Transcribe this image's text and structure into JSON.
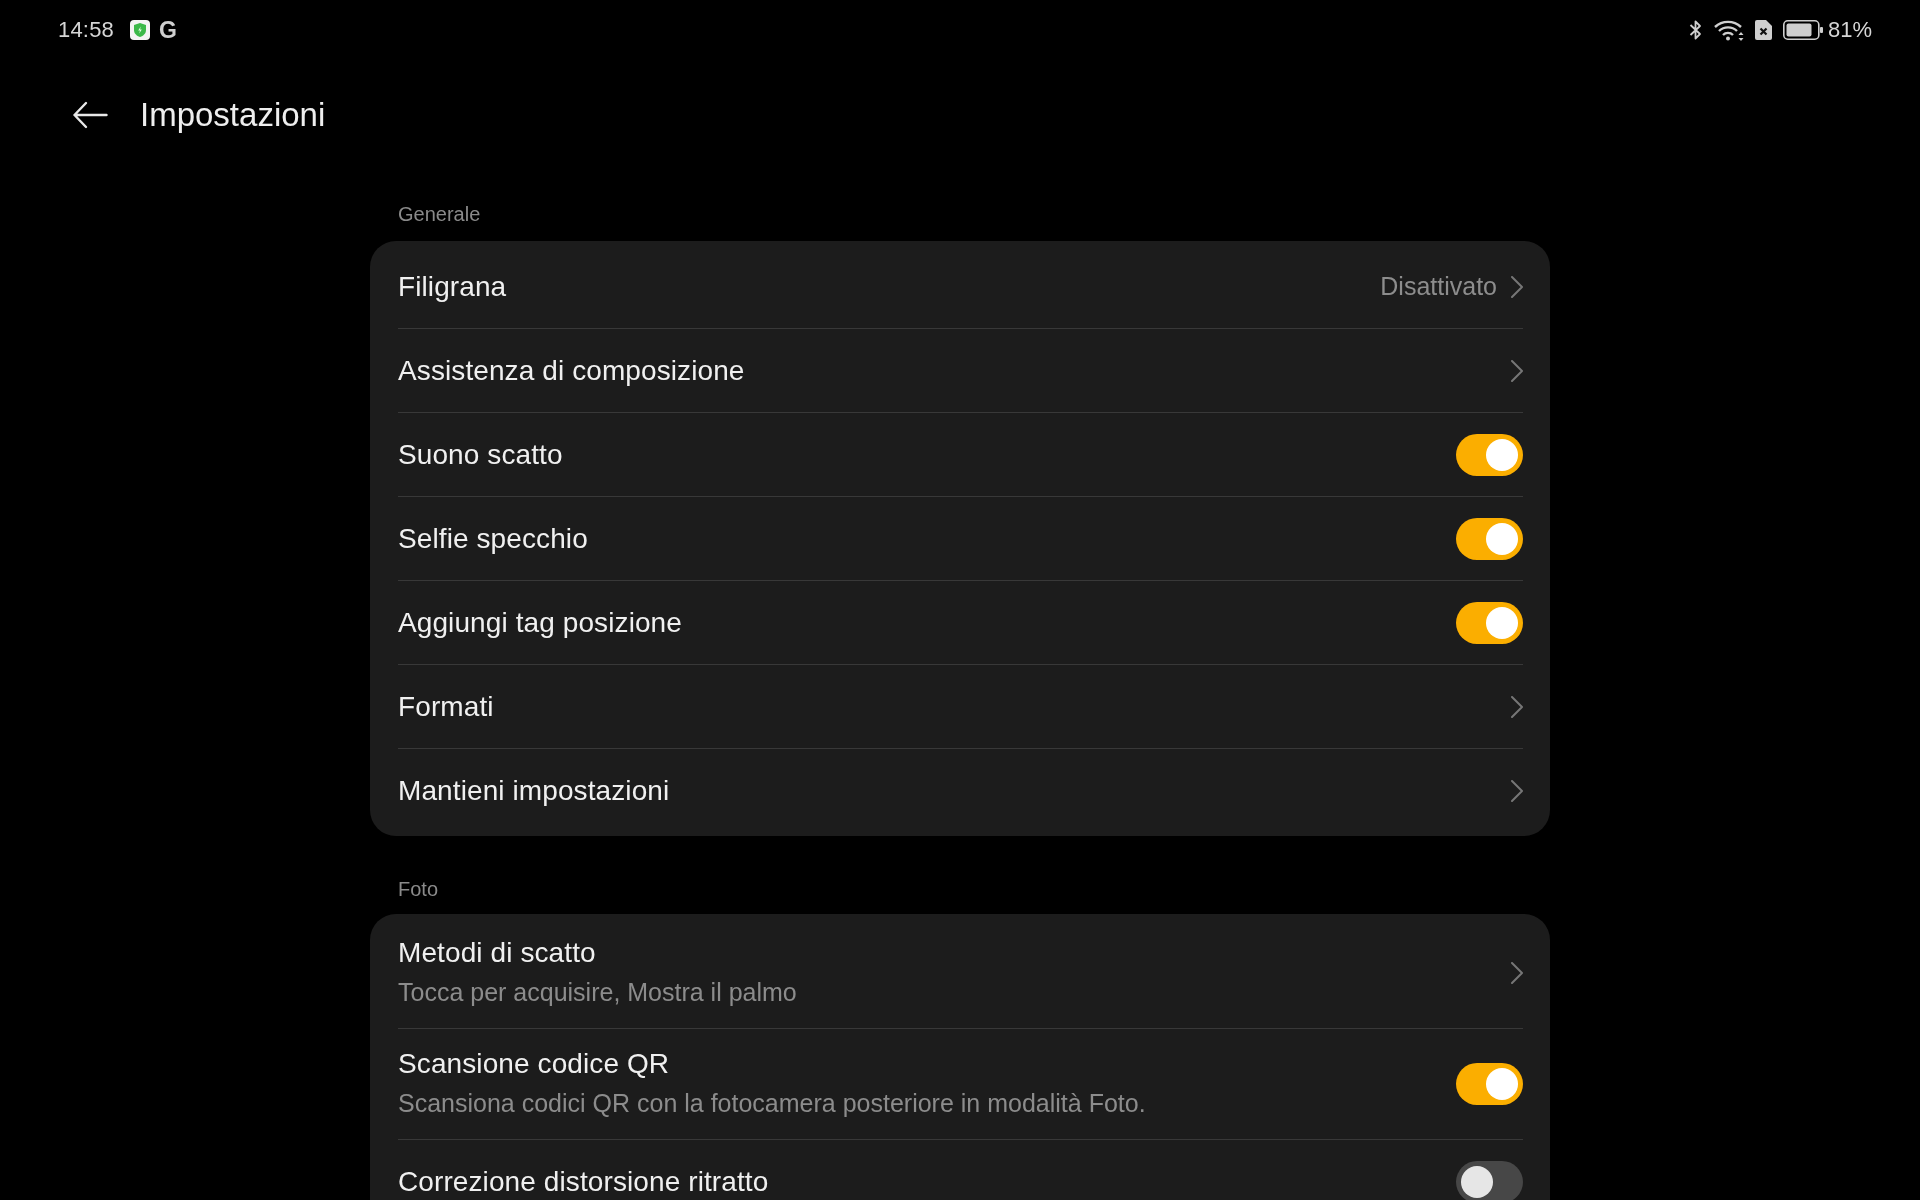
{
  "status_bar": {
    "time": "14:58",
    "notification": "G",
    "battery": "81%"
  },
  "header": {
    "title": "Impostazioni"
  },
  "sections": [
    {
      "title": "Generale",
      "items": [
        {
          "kind": "link",
          "label": "Filigrana",
          "value": "Disattivato"
        },
        {
          "kind": "link",
          "label": "Assistenza di composizione"
        },
        {
          "kind": "toggle",
          "label": "Suono scatto",
          "on": true
        },
        {
          "kind": "toggle",
          "label": "Selfie specchio",
          "on": true
        },
        {
          "kind": "toggle",
          "label": "Aggiungi tag posizione",
          "on": true
        },
        {
          "kind": "link",
          "label": "Formati"
        },
        {
          "kind": "link",
          "label": "Mantieni impostazioni"
        }
      ]
    },
    {
      "title": "Foto",
      "items": [
        {
          "kind": "link",
          "label": "Metodi di scatto",
          "description": "Tocca per acquisire, Mostra il palmo"
        },
        {
          "kind": "toggle",
          "label": "Scansione codice QR",
          "description": "Scansiona codici QR con la fotocamera posteriore in modalità Foto.",
          "on": true
        },
        {
          "kind": "toggle",
          "label": "Correzione distorsione ritratto",
          "on": false
        }
      ]
    }
  ]
}
